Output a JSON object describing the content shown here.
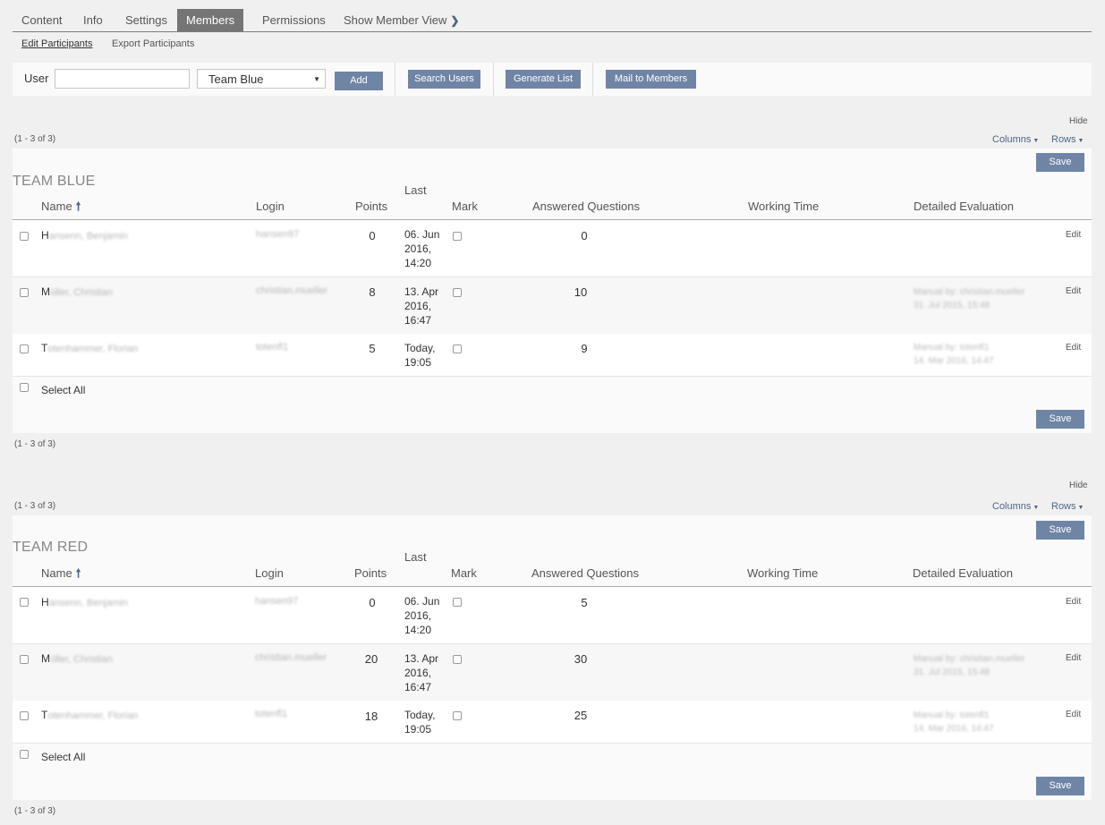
{
  "tabs": [
    {
      "label": "Content",
      "active": false
    },
    {
      "label": "Info",
      "active": false
    },
    {
      "label": "Settings",
      "active": false
    },
    {
      "label": "Members",
      "active": true
    },
    {
      "label": "Permissions",
      "active": false
    },
    {
      "label": "Show Member View",
      "active": false,
      "icon": "chevron-right-icon"
    }
  ],
  "subtabs": [
    {
      "label": "Edit Participants",
      "active": true
    },
    {
      "label": "Export Participants",
      "active": false
    }
  ],
  "toolbar": {
    "user_label": "User",
    "user_value": "",
    "team_select": "Team Blue",
    "add": "Add",
    "search_users": "Search Users",
    "generate_list": "Generate List",
    "mail_to_members": "Mail to Members"
  },
  "tables": [
    {
      "title": "TEAM BLUE",
      "count": "(1 - 3 of 3)",
      "hide": "Hide",
      "columns_btn": "Columns",
      "rows_btn": "Rows",
      "save": "Save",
      "headers": {
        "name": "Name",
        "login": "Login",
        "points": "Points",
        "last": "Last",
        "mark": "Mark",
        "answered": "Answered Questions",
        "working": "Working Time",
        "detailed": "Detailed Evaluation"
      },
      "rows": [
        {
          "initial": "H",
          "name_rest": "ansenn, Benjamin",
          "login": "hansen97",
          "points": "0",
          "last": [
            "06. Jun",
            "2016,",
            "14:20"
          ],
          "answered": "0",
          "eval": [
            "",
            ""
          ],
          "edit": "Edit"
        },
        {
          "initial": "M",
          "name_rest": "üller, Christian",
          "login": "christian.mueller",
          "points": "8",
          "last": [
            "13. Apr",
            "2016,",
            "16:47"
          ],
          "answered": "10",
          "eval": [
            "Manual by: christian.mueller",
            "31. Jul 2015, 15:48"
          ],
          "edit": "Edit"
        },
        {
          "initial": "T",
          "name_rest": "otenhammer, Florian",
          "login": "totenfl1",
          "points": "5",
          "last": [
            "Today,",
            "19:05"
          ],
          "answered": "9",
          "eval": [
            "Manual by: totenfl1",
            "14. Mar 2016, 14:47"
          ],
          "edit": "Edit"
        }
      ],
      "select_all": "Select All"
    },
    {
      "title": "TEAM RED",
      "count": "(1 - 3 of 3)",
      "hide": "Hide",
      "columns_btn": "Columns",
      "rows_btn": "Rows",
      "save": "Save",
      "headers": {
        "name": "Name",
        "login": "Login",
        "points": "Points",
        "last": "Last",
        "mark": "Mark",
        "answered": "Answered Questions",
        "working": "Working Time",
        "detailed": "Detailed Evaluation"
      },
      "rows": [
        {
          "initial": "H",
          "name_rest": "ansenn, Benjamin",
          "login": "hansen97",
          "points": "0",
          "last": [
            "06. Jun",
            "2016,",
            "14:20"
          ],
          "answered": "5",
          "eval": [
            "",
            ""
          ],
          "edit": "Edit"
        },
        {
          "initial": "M",
          "name_rest": "üller, Christian",
          "login": "christian.mueller",
          "points": "20",
          "last": [
            "13. Apr",
            "2016,",
            "16:47"
          ],
          "answered": "30",
          "eval": [
            "Manual by: christian.mueller",
            "31. Jul 2015, 15:48"
          ],
          "edit": "Edit"
        },
        {
          "initial": "T",
          "name_rest": "otenhammer, Florian",
          "login": "totenfl1",
          "points": "18",
          "last": [
            "Today,",
            "19:05"
          ],
          "answered": "25",
          "eval": [
            "Manual by: totenfl1",
            "14. Mar 2016, 14:47"
          ],
          "edit": "Edit"
        }
      ],
      "select_all": "Select All"
    }
  ],
  "colors": {
    "accent": "#6f85a6",
    "tab_active": "#757575",
    "link": "#4c6586"
  }
}
